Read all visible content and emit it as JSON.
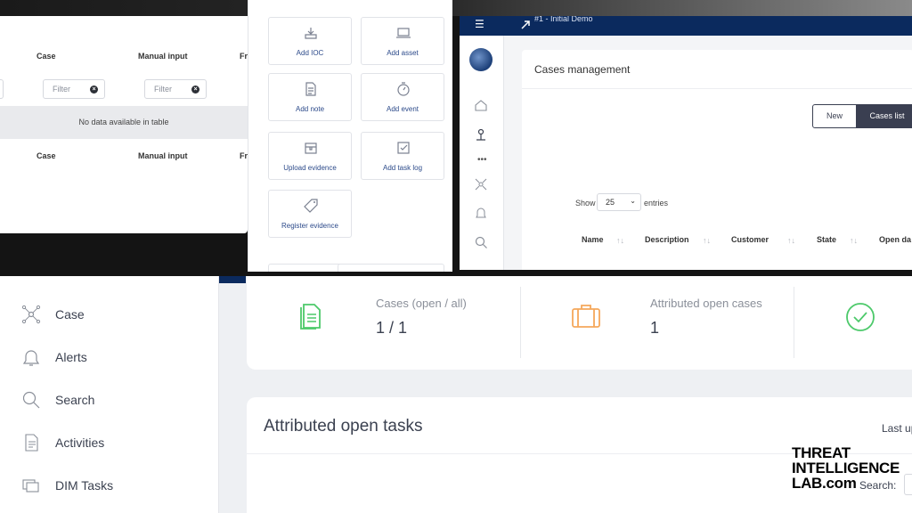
{
  "table_panel": {
    "headers_top": [
      "Case",
      "Manual input",
      "Fr"
    ],
    "filter_placeholder": "Filter",
    "empty_message": "No data available in table",
    "headers_bottom": [
      "Case",
      "Manual input",
      "Fr"
    ]
  },
  "actions_panel": {
    "tiles": [
      {
        "label": "Add IOC",
        "icon": "ioc-icon"
      },
      {
        "label": "Add asset",
        "icon": "laptop-icon"
      },
      {
        "label": "Add note",
        "icon": "note-icon"
      },
      {
        "label": "Add event",
        "icon": "stopwatch-icon"
      },
      {
        "label": "Upload evidence",
        "icon": "box-icon"
      },
      {
        "label": "Add task log",
        "icon": "checkbox-icon"
      },
      {
        "label": "Register evidence",
        "icon": "tag-icon"
      }
    ]
  },
  "cases_panel": {
    "breadcrumb": "#1 - Initial Demo",
    "title": "Cases management",
    "new_button": "New",
    "list_button": "Cases list",
    "show_label": "Show",
    "page_size": "25",
    "entries_label": "entries",
    "columns": [
      "Name",
      "Description",
      "Customer",
      "State",
      "Open da"
    ]
  },
  "dashboard": {
    "sidebar": [
      {
        "label": "Case",
        "icon": "case-network-icon"
      },
      {
        "label": "Alerts",
        "icon": "bell-icon"
      },
      {
        "label": "Search",
        "icon": "search-icon"
      },
      {
        "label": "Activities",
        "icon": "activities-icon"
      },
      {
        "label": "DIM Tasks",
        "icon": "tasks-icon"
      }
    ],
    "stats": [
      {
        "label": "Cases (open / all)",
        "value": "1 / 1",
        "color": "#4cc96a"
      },
      {
        "label": "Attributed open cases",
        "value": "1",
        "color": "#f5a85b"
      },
      {
        "label": "",
        "value": "",
        "color": "#4cc96a"
      }
    ],
    "tasks_title": "Attributed open tasks",
    "last_update": "Last up",
    "search_label": "Search:"
  },
  "logo": [
    "THREAT",
    "INTELLIGENCE",
    "LAB.com"
  ]
}
